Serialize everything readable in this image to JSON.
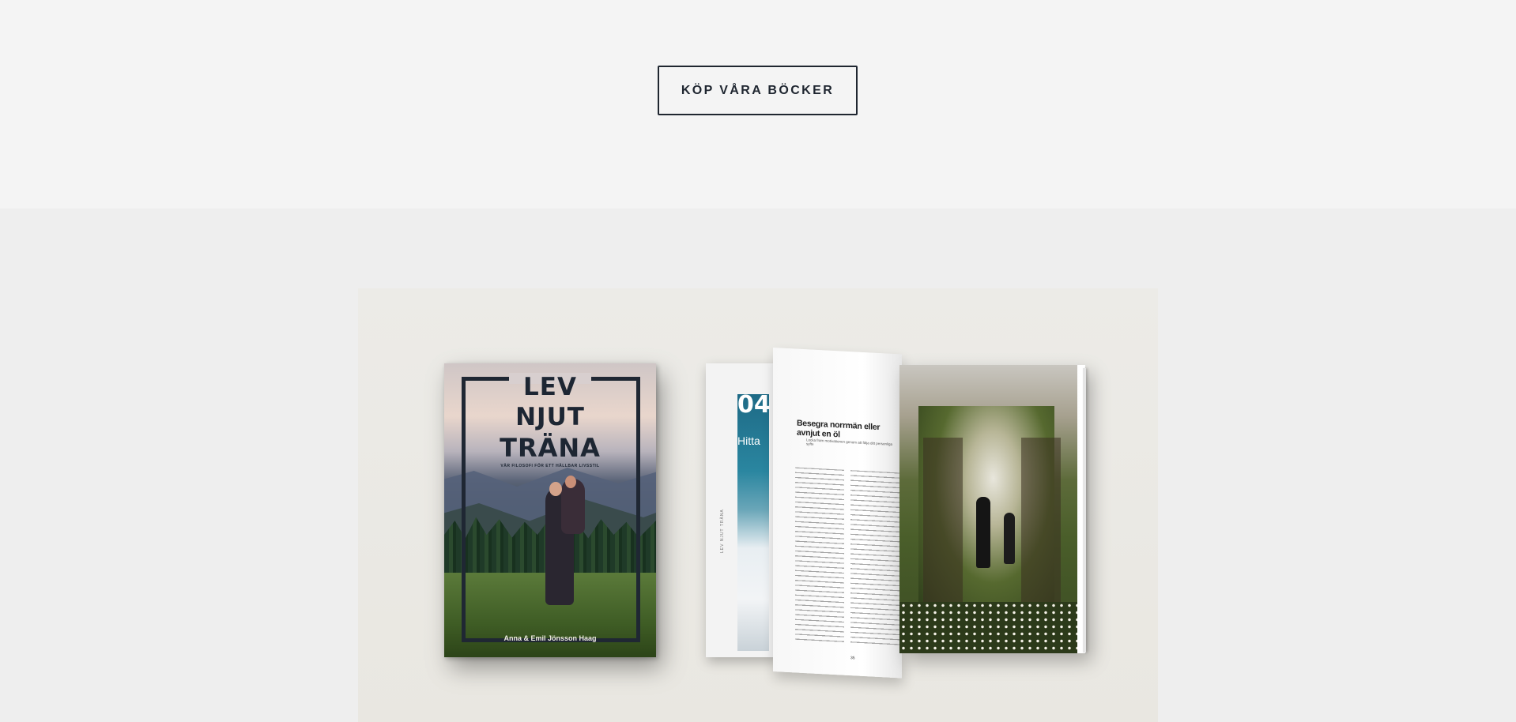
{
  "cta": {
    "label": "KÖP VÅRA BÖCKER"
  },
  "book_cover": {
    "title_lines": [
      "LEV",
      "NJUT",
      "TRÄNA"
    ],
    "subtitle": "VÅR FILOSOFI FÖR ETT HÅLLBAR LIVSSTIL",
    "authors": "Anna & Emil Jönsson Haag"
  },
  "open_book": {
    "chapter_number": "04",
    "chapter_heading": "Hitta",
    "spine_text": "LEV NJUT TRÄNA",
    "page_title": "Besegra norrmän eller avnjut en öl",
    "page_subtitle": "Locka fram motivationen genom att följa ditt personliga syfte",
    "page_number": "35"
  }
}
